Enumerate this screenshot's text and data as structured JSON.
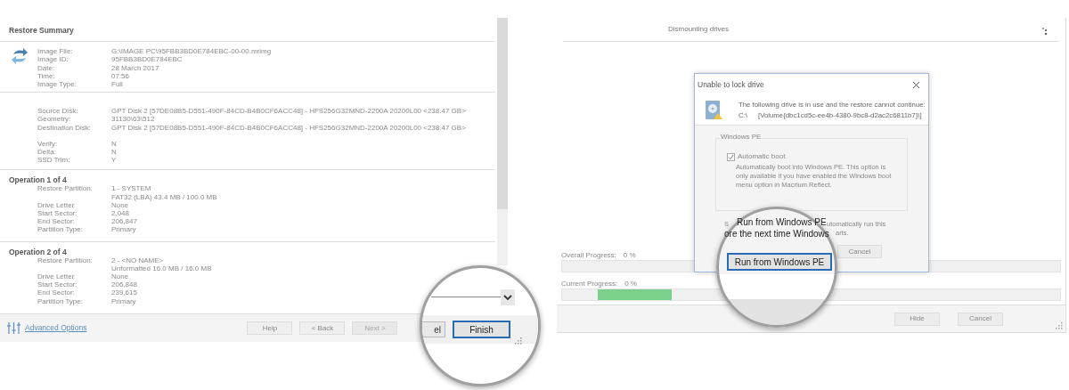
{
  "restore_wizard": {
    "section_title": "Restore Summary",
    "image_info": [
      {
        "label": "Image File:",
        "values": [
          "G:\\IMAGE PC\\95FBB3BD0E784EBC-00-00.mrimg"
        ]
      },
      {
        "label": "Image ID:",
        "values": [
          "95FBB3BD0E784EBC"
        ]
      },
      {
        "label": "Date:",
        "values": [
          "28 March 2017"
        ]
      },
      {
        "label": "Time:",
        "values": [
          "07:56"
        ]
      },
      {
        "label": "Image Type:",
        "values": [
          "Full"
        ]
      }
    ],
    "disk_info": [
      {
        "label": "Source Disk:",
        "values": [
          "GPT Disk 2 [57DE08B5-D551-490F-84CD-B4B0CF6ACC48] - HFS256G32MND-2200A 20200L00  <238.47 GB>"
        ]
      },
      {
        "label": "Geometry:",
        "values": [
          "31130\\63\\512"
        ]
      },
      {
        "label": "Destination Disk:",
        "values": [
          "GPT Disk 2 [57DE08B5-D551-490F-84CD-B4B0CF6ACC48] - HFS256G32MND-2200A 20200L00  <238.47 GB>"
        ]
      }
    ],
    "options": [
      {
        "label": "Verify:",
        "values": [
          "N"
        ]
      },
      {
        "label": "Delta:",
        "values": [
          "N"
        ]
      },
      {
        "label": "SSD Trim:",
        "values": [
          "Y"
        ]
      }
    ],
    "operations": [
      {
        "title": "Operation 1 of 4",
        "fields": [
          {
            "label": "Restore Partition:",
            "values": [
              "1 - SYSTEM",
              "FAT32 (LBA) 43.4 MB / 100.0 MB"
            ]
          },
          {
            "label": "Drive Letter",
            "values": [
              "None"
            ]
          },
          {
            "label": "Start Sector:",
            "values": [
              "2,048"
            ]
          },
          {
            "label": "End Sector:",
            "values": [
              "206,847"
            ]
          },
          {
            "label": "Partition Type:",
            "values": [
              "Primary"
            ]
          }
        ]
      },
      {
        "title": "Operation 2 of 4",
        "fields": [
          {
            "label": "Restore Partition:",
            "values": [
              "2 - <NO NAME>",
              "Unformatted 16.0 MB / 16.0 MB"
            ]
          },
          {
            "label": "Drive Letter",
            "values": [
              "None"
            ]
          },
          {
            "label": "Start Sector:",
            "values": [
              "206,848"
            ]
          },
          {
            "label": "End Sector:",
            "values": [
              "239,615"
            ]
          },
          {
            "label": "Partition Type:",
            "values": [
              "Primary"
            ]
          }
        ]
      }
    ],
    "footer": {
      "link": "Advanced Options",
      "buttons": [
        {
          "label": "Help",
          "disabled": false
        },
        {
          "label": "< Back",
          "disabled": false
        },
        {
          "label": "Next >",
          "disabled": true
        }
      ]
    },
    "magnifier": {
      "partial_button": "el",
      "button": "Finish"
    }
  },
  "restore_progress": {
    "status": "Dismounting drives",
    "overall": {
      "label": "Overall Progress:",
      "value": "0 %",
      "level": 0
    },
    "current": {
      "label": "Current Progress:",
      "value": "0 %",
      "level": 0.16
    },
    "buttons": [
      "Hide",
      "Cancel"
    ],
    "dialog": {
      "title": "Unable to lock drive",
      "message": "The following drive is  in use and the restore cannot continue:",
      "drive": "C:\\",
      "volume": "[Volume{dbc1cd5c-ee4b-4380-9bc8-d2ac2c6811b7}\\]",
      "group_title": "Windows PE",
      "auto_boot": {
        "label": "Automatic boot",
        "checked": true,
        "description_lines": [
          "Automatically boot into Windows PE. This option is",
          "only available if you have enabled the Windows boot",
          "menu option in Macrium Reflect."
        ]
      },
      "partial_left": "S",
      "partial_right": [
        "utomatically run this",
        "arts."
      ],
      "cancel": "Cancel"
    },
    "magnifier": {
      "heading": "Run from Windows PE",
      "line": "ore the next time Windows",
      "button": "Run from Windows PE"
    }
  }
}
